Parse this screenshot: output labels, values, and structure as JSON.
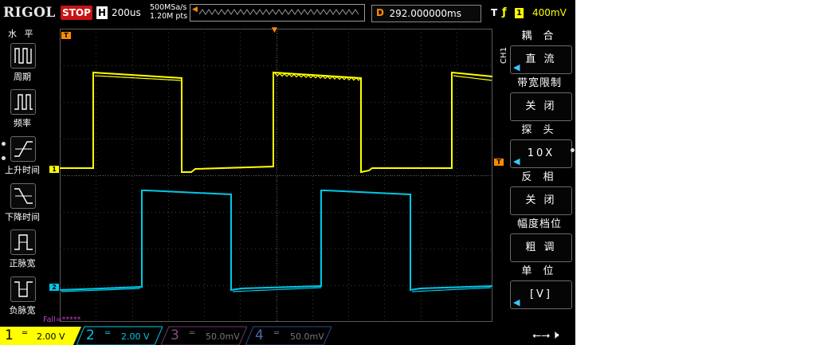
{
  "header": {
    "brand": "RIGOL",
    "run_state": "STOP",
    "h_key": "H",
    "timebase": "200us",
    "sample_rate": "500MSa/s",
    "memory_depth": "1.20M pts",
    "delay_key": "D",
    "delay_value": "292.000000ms",
    "trigger_key": "T",
    "trigger_source": "1",
    "trigger_level": "400mV"
  },
  "left_menu": {
    "title": "水 平",
    "items": [
      {
        "label": "周期",
        "icon": "period-icon"
      },
      {
        "label": "频率",
        "icon": "frequency-icon"
      },
      {
        "label": "上升时间",
        "icon": "rise-time-icon"
      },
      {
        "label": "下降时间",
        "icon": "fall-time-icon"
      },
      {
        "label": "正脉宽",
        "icon": "positive-width-icon"
      },
      {
        "label": "负脉宽",
        "icon": "negative-width-icon"
      }
    ]
  },
  "right_menu": {
    "channel": "CH1",
    "groups": [
      {
        "title": "耦 合",
        "value": "直 流"
      },
      {
        "title": "带宽限制",
        "value": "关 闭"
      },
      {
        "title": "探 头",
        "value": "10X"
      },
      {
        "title": "反 相",
        "value": "关 闭"
      },
      {
        "title": "幅度档位",
        "value": "粗 调"
      },
      {
        "title": "单 位",
        "value": "[V]"
      }
    ]
  },
  "display": {
    "trigger_marker": "T",
    "ch1_marker": "1",
    "ch2_marker": "2",
    "level_marker": "T"
  },
  "status": {
    "measure_text": "Fall=*****"
  },
  "channels": [
    {
      "num": "1",
      "scale": "2.00 V",
      "color": "#ffff00",
      "active": true
    },
    {
      "num": "2",
      "scale": "2.00 V",
      "color": "#00c8e6",
      "active": true
    },
    {
      "num": "3",
      "scale": "50.0mV",
      "color": "#c040c0",
      "active": false
    },
    {
      "num": "4",
      "scale": "50.0mV",
      "color": "#3c78ff",
      "active": false
    }
  ],
  "colors": {
    "ch1": "#ffff00",
    "ch2": "#00c8e6",
    "trigger": "#ff8c00",
    "stop": "#c81414"
  }
}
